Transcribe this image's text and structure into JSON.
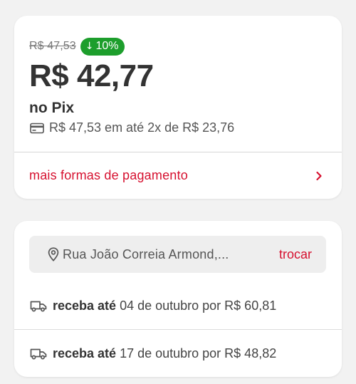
{
  "price": {
    "old_price": "R$ 47,53",
    "discount_arrow": "↓",
    "discount": "10%",
    "current_price": "R$ 42,77",
    "method": "no Pix",
    "installments": "R$ 47,53 em até 2x de R$ 23,76",
    "more_payment": "mais formas de pagamento"
  },
  "shipping": {
    "address": "Rua João Correia Armond,...",
    "change_label": "trocar",
    "options": [
      {
        "bold": "receba até",
        "text": "04 de outubro por R$ 60,81"
      },
      {
        "bold": "receba até",
        "text": "17 de outubro por R$ 48,82"
      }
    ]
  },
  "colors": {
    "accent": "#d6102f",
    "discount_badge": "#1d9e2c",
    "card_bg": "#ffffff",
    "page_bg": "#f2f2f2"
  },
  "icons": [
    "credit-card-icon",
    "chevron-right-icon",
    "location-pin-icon",
    "truck-icon"
  ]
}
